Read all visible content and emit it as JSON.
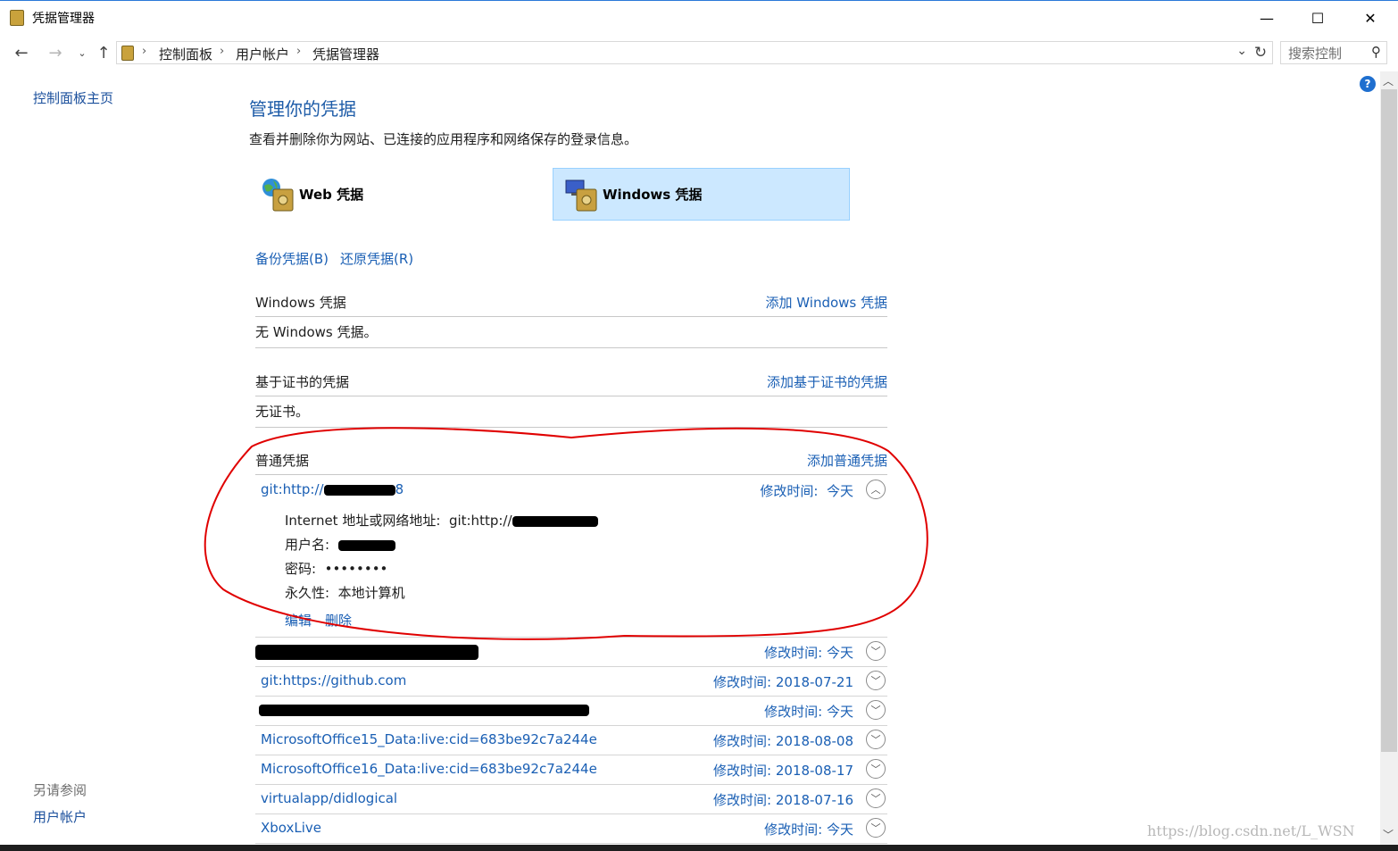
{
  "window": {
    "title": "凭据管理器",
    "minimize": "—",
    "maximize": "☐",
    "close": "✕"
  },
  "address": {
    "breadcrumbs": [
      "控制面板",
      "用户帐户",
      "凭据管理器"
    ],
    "search_placeholder": "搜索控制"
  },
  "leftnav": {
    "home": "控制面板主页",
    "see_also": "另请参阅",
    "user_accounts": "用户帐户"
  },
  "main": {
    "title": "管理你的凭据",
    "subtitle": "查看并删除你为网站、已连接的应用程序和网络保存的登录信息。",
    "tabs": [
      {
        "label": "Web 凭据"
      },
      {
        "label": "Windows 凭据"
      }
    ],
    "backup": "备份凭据(B)",
    "restore": "还原凭据(R)"
  },
  "sections": {
    "windows": {
      "heading": "Windows 凭据",
      "add": "添加 Windows 凭据",
      "empty": "无 Windows 凭据。"
    },
    "cert": {
      "heading": "基于证书的凭据",
      "add": "添加基于证书的凭据",
      "empty": "无证书。"
    },
    "generic": {
      "heading": "普通凭据",
      "add": "添加普通凭据"
    }
  },
  "expanded": {
    "name_prefix": "git:http://",
    "name_suffix": "8",
    "modified_label": "修改时间:",
    "modified_value": "今天",
    "address_label": "Internet 地址或网络地址:",
    "address_value": "git:http://",
    "username_label": "用户名:",
    "password_label": "密码:",
    "password_value": "••••••••",
    "persistence_label": "永久性:",
    "persistence_value": "本地计算机",
    "edit": "编辑",
    "delete": "删除"
  },
  "credentials": [
    {
      "name": "",
      "modified": "修改时间:  今天"
    },
    {
      "name": "git:https://github.com",
      "modified": "修改时间:  2018-07-21"
    },
    {
      "name": "",
      "modified": "修改时间:  今天"
    },
    {
      "name": "MicrosoftOffice15_Data:live:cid=683be92c7a244e",
      "modified": "修改时间:  2018-08-08"
    },
    {
      "name": "MicrosoftOffice16_Data:live:cid=683be92c7a244e",
      "modified": "修改时间:  2018-08-17"
    },
    {
      "name": "virtualapp/didlogical",
      "modified": "修改时间:  2018-07-16"
    },
    {
      "name": "XboxLive",
      "modified": "修改时间:  今天"
    }
  ],
  "watermark": "https://blog.csdn.net/L_WSN",
  "colors": {
    "link": "#1a5fb4",
    "title": "#1e5ca8",
    "selected_tab": "#cce8ff",
    "annotation": "#e00000"
  }
}
